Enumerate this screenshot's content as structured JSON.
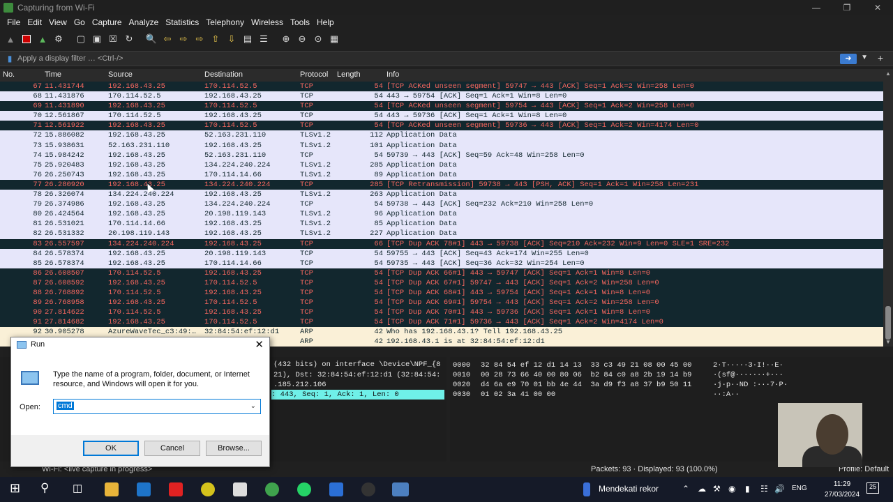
{
  "window": {
    "title": "Capturing from Wi-Fi"
  },
  "menu": [
    "File",
    "Edit",
    "View",
    "Go",
    "Capture",
    "Analyze",
    "Statistics",
    "Telephony",
    "Wireless",
    "Tools",
    "Help"
  ],
  "filter": {
    "placeholder": "Apply a display filter … <Ctrl-/>"
  },
  "columns": {
    "no": "No.",
    "time": "Time",
    "source": "Source",
    "destination": "Destination",
    "protocol": "Protocol",
    "length": "Length",
    "info": "Info"
  },
  "packets": [
    {
      "no": "67",
      "time": "11.431744",
      "src": "192.168.43.25",
      "dst": "170.114.52.5",
      "proto": "TCP",
      "len": "54",
      "info": "[TCP ACKed unseen segment] 59747 → 443 [ACK] Seq=1 Ack=2 Win=258 Len=0",
      "style": "bad"
    },
    {
      "no": "68",
      "time": "11.431876",
      "src": "170.114.52.5",
      "dst": "192.168.43.25",
      "proto": "TCP",
      "len": "54",
      "info": "443 → 59754 [ACK] Seq=1 Ack=1 Win=8 Len=0",
      "style": "norm"
    },
    {
      "no": "69",
      "time": "11.431890",
      "src": "192.168.43.25",
      "dst": "170.114.52.5",
      "proto": "TCP",
      "len": "54",
      "info": "[TCP ACKed unseen segment] 59754 → 443 [ACK] Seq=1 Ack=2 Win=258 Len=0",
      "style": "bad"
    },
    {
      "no": "70",
      "time": "12.561867",
      "src": "170.114.52.5",
      "dst": "192.168.43.25",
      "proto": "TCP",
      "len": "54",
      "info": "443 → 59736 [ACK] Seq=1 Ack=1 Win=8 Len=0",
      "style": "norm"
    },
    {
      "no": "71",
      "time": "12.561922",
      "src": "192.168.43.25",
      "dst": "170.114.52.5",
      "proto": "TCP",
      "len": "54",
      "info": "[TCP ACKed unseen segment] 59736 → 443 [ACK] Seq=1 Ack=2 Win=4174 Len=0",
      "style": "bad"
    },
    {
      "no": "72",
      "time": "15.886082",
      "src": "192.168.43.25",
      "dst": "52.163.231.110",
      "proto": "TLSv1.2",
      "len": "112",
      "info": "Application Data",
      "style": "norm"
    },
    {
      "no": "73",
      "time": "15.938631",
      "src": "52.163.231.110",
      "dst": "192.168.43.25",
      "proto": "TLSv1.2",
      "len": "101",
      "info": "Application Data",
      "style": "norm"
    },
    {
      "no": "74",
      "time": "15.984242",
      "src": "192.168.43.25",
      "dst": "52.163.231.110",
      "proto": "TCP",
      "len": "54",
      "info": "59739 → 443 [ACK] Seq=59 Ack=48 Win=258 Len=0",
      "style": "norm"
    },
    {
      "no": "75",
      "time": "25.920483",
      "src": "192.168.43.25",
      "dst": "134.224.240.224",
      "proto": "TLSv1.2",
      "len": "285",
      "info": "Application Data",
      "style": "norm"
    },
    {
      "no": "76",
      "time": "26.250743",
      "src": "192.168.43.25",
      "dst": "170.114.14.66",
      "proto": "TLSv1.2",
      "len": "89",
      "info": "Application Data",
      "style": "norm"
    },
    {
      "no": "77",
      "time": "26.280920",
      "src": "192.168.43.25",
      "dst": "134.224.240.224",
      "proto": "TCP",
      "len": "285",
      "info": "[TCP Retransmission] 59738 → 443 [PSH, ACK] Seq=1 Ack=1 Win=258 Len=231",
      "style": "retrans"
    },
    {
      "no": "78",
      "time": "26.326074",
      "src": "134.224.240.224",
      "dst": "192.168.43.25",
      "proto": "TLSv1.2",
      "len": "263",
      "info": "Application Data",
      "style": "norm"
    },
    {
      "no": "79",
      "time": "26.374986",
      "src": "192.168.43.25",
      "dst": "134.224.240.224",
      "proto": "TCP",
      "len": "54",
      "info": "59738 → 443 [ACK] Seq=232 Ack=210 Win=258 Len=0",
      "style": "norm"
    },
    {
      "no": "80",
      "time": "26.424564",
      "src": "192.168.43.25",
      "dst": "20.198.119.143",
      "proto": "TLSv1.2",
      "len": "96",
      "info": "Application Data",
      "style": "norm"
    },
    {
      "no": "81",
      "time": "26.531021",
      "src": "170.114.14.66",
      "dst": "192.168.43.25",
      "proto": "TLSv1.2",
      "len": "85",
      "info": "Application Data",
      "style": "norm"
    },
    {
      "no": "82",
      "time": "26.531332",
      "src": "20.198.119.143",
      "dst": "192.168.43.25",
      "proto": "TLSv1.2",
      "len": "227",
      "info": "Application Data",
      "style": "norm"
    },
    {
      "no": "83",
      "time": "26.557597",
      "src": "134.224.240.224",
      "dst": "192.168.43.25",
      "proto": "TCP",
      "len": "66",
      "info": "[TCP Dup ACK 78#1] 443 → 59738 [ACK] Seq=210 Ack=232 Win=9 Len=0 SLE=1 SRE=232",
      "style": "bad"
    },
    {
      "no": "84",
      "time": "26.578374",
      "src": "192.168.43.25",
      "dst": "20.198.119.143",
      "proto": "TCP",
      "len": "54",
      "info": "59755 → 443 [ACK] Seq=43 Ack=174 Win=255 Len=0",
      "style": "norm"
    },
    {
      "no": "85",
      "time": "26.578374",
      "src": "192.168.43.25",
      "dst": "170.114.14.66",
      "proto": "TCP",
      "len": "54",
      "info": "59735 → 443 [ACK] Seq=36 Ack=32 Win=254 Len=0",
      "style": "norm"
    },
    {
      "no": "86",
      "time": "26.608507",
      "src": "170.114.52.5",
      "dst": "192.168.43.25",
      "proto": "TCP",
      "len": "54",
      "info": "[TCP Dup ACK 66#1] 443 → 59747 [ACK] Seq=1 Ack=1 Win=8 Len=0",
      "style": "bad"
    },
    {
      "no": "87",
      "time": "26.608592",
      "src": "192.168.43.25",
      "dst": "170.114.52.5",
      "proto": "TCP",
      "len": "54",
      "info": "[TCP Dup ACK 67#1] 59747 → 443 [ACK] Seq=1 Ack=2 Win=258 Len=0",
      "style": "bad"
    },
    {
      "no": "88",
      "time": "26.768892",
      "src": "170.114.52.5",
      "dst": "192.168.43.25",
      "proto": "TCP",
      "len": "54",
      "info": "[TCP Dup ACK 68#1] 443 → 59754 [ACK] Seq=1 Ack=1 Win=8 Len=0",
      "style": "bad"
    },
    {
      "no": "89",
      "time": "26.768958",
      "src": "192.168.43.25",
      "dst": "170.114.52.5",
      "proto": "TCP",
      "len": "54",
      "info": "[TCP Dup ACK 69#1] 59754 → 443 [ACK] Seq=1 Ack=2 Win=258 Len=0",
      "style": "bad"
    },
    {
      "no": "90",
      "time": "27.814622",
      "src": "170.114.52.5",
      "dst": "192.168.43.25",
      "proto": "TCP",
      "len": "54",
      "info": "[TCP Dup ACK 70#1] 443 → 59736 [ACK] Seq=1 Ack=1 Win=8 Len=0",
      "style": "bad"
    },
    {
      "no": "91",
      "time": "27.814682",
      "src": "192.168.43.25",
      "dst": "170.114.52.5",
      "proto": "TCP",
      "len": "54",
      "info": "[TCP Dup ACK 71#1] 59736 → 443 [ACK] Seq=1 Ack=2 Win=4174 Len=0",
      "style": "bad"
    },
    {
      "no": "92",
      "time": "30.905278",
      "src": "AzureWaveTec_c3:49:…",
      "dst": "32:84:54:ef:12:d1",
      "proto": "ARP",
      "len": "42",
      "info": "Who has 192.168.43.1? Tell 192.168.43.25",
      "style": "arp"
    },
    {
      "no": "",
      "time": "",
      "src": "",
      "dst": "…49:…",
      "proto": "ARP",
      "len": "42",
      "info": "192.168.43.1 is at 32:84:54:ef:12:d1",
      "style": "arp"
    }
  ],
  "detail": {
    "line1": "(432 bits) on interface \\Device\\NPF_{8",
    "line2": "21), Dst: 32:84:54:ef:12:d1 (32:84:54:",
    "line3": ".185.212.106",
    "line4": ": 443, Seq: 1, Ack: 1, Len: 0"
  },
  "hex": [
    {
      "off": "0000",
      "bytes": "32 84 54 ef 12 d1 14 13  33 c3 49 21 08 00 45 00",
      "ascii": "2·T·····3·I!··E·"
    },
    {
      "off": "0010",
      "bytes": "00 28 73 66 40 00 80 06  b2 84 c0 a8 2b 19 14 b9",
      "ascii": "·(sf@·······+···"
    },
    {
      "off": "0020",
      "bytes": "d4 6a e9 70 01 bb 4e 44  3a d9 f3 a8 37 b9 50 11",
      "ascii": "·j·p··ND :···7·P·"
    },
    {
      "off": "0030",
      "bytes": "01 02 3a 41 00 00",
      "ascii": "··:A··"
    }
  ],
  "status": {
    "left": "Wi-Fi: <live capture in progress>",
    "packets": "Packets: 93 · Displayed: 93 (100.0%)",
    "profile": "Profile: Default"
  },
  "run": {
    "title": "Run",
    "description": "Type the name of a program, folder, document, or Internet resource, and Windows will open it for you.",
    "open_label": "Open:",
    "open_value": "cmd",
    "ok": "OK",
    "cancel": "Cancel",
    "browse": "Browse..."
  },
  "taskbar": {
    "news": "Mendekati rekor",
    "lang": "ENG",
    "time": "11:29",
    "date": "27/03/2024",
    "notifications": "25"
  }
}
